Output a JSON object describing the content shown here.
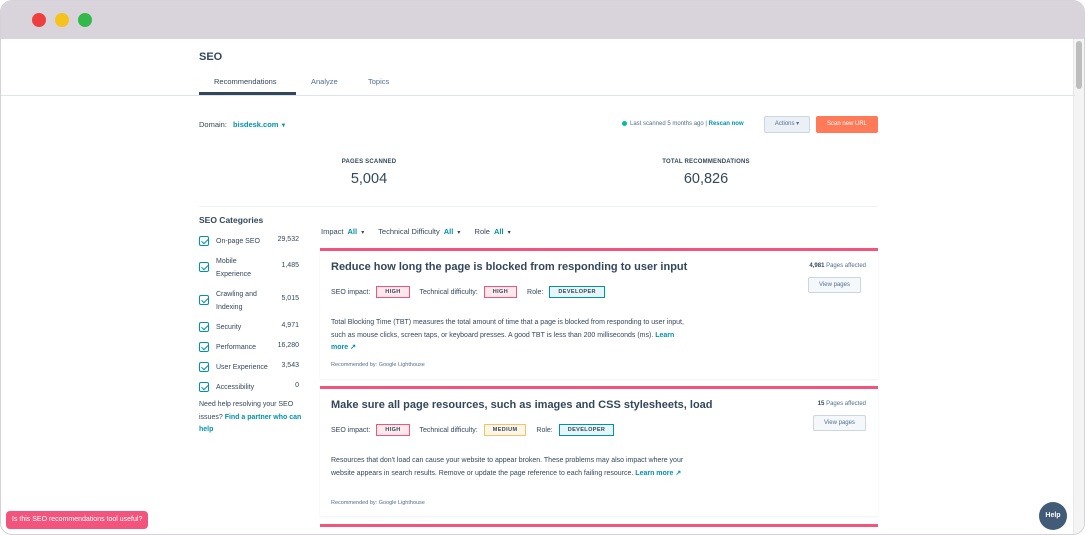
{
  "window": {
    "controls": [
      "close",
      "minimize",
      "maximize"
    ]
  },
  "page": {
    "title": "SEO",
    "tabs": [
      {
        "label": "Recommendations",
        "active": true
      },
      {
        "label": "Analyze",
        "active": false
      },
      {
        "label": "Topics",
        "active": false
      }
    ]
  },
  "domain": {
    "label": "Domain:",
    "value": "bisdesk.com"
  },
  "status": {
    "text": "Last scanned 5 months ago",
    "separator": "|",
    "rescan": "Rescan now",
    "actions": "Actions",
    "scan_new": "Scan new URL"
  },
  "stats": {
    "pages_scanned_label": "PAGES SCANNED",
    "pages_scanned_value": "5,004",
    "total_recs_label": "TOTAL RECOMMENDATIONS",
    "total_recs_value": "60,826"
  },
  "sidebar": {
    "title": "SEO Categories",
    "categories": [
      {
        "label": "On-page SEO",
        "count": "29,532",
        "checked": true
      },
      {
        "label": "Mobile Experience",
        "count": "1,485",
        "checked": true
      },
      {
        "label": "Crawling and Indexing",
        "count": "5,015",
        "checked": true
      },
      {
        "label": "Security",
        "count": "4,971",
        "checked": true
      },
      {
        "label": "Performance",
        "count": "16,280",
        "checked": true
      },
      {
        "label": "User Experience",
        "count": "3,543",
        "checked": true
      },
      {
        "label": "Accessibility",
        "count": "0",
        "checked": true
      }
    ],
    "help_text": "Need help resolving your SEO issues?",
    "help_link": "Find a partner who can help"
  },
  "filters": [
    {
      "label": "Impact",
      "value": "All"
    },
    {
      "label": "Technical Difficulty",
      "value": "All"
    },
    {
      "label": "Role",
      "value": "All"
    }
  ],
  "cards": [
    {
      "title": "Reduce how long the page is blocked from responding to user input",
      "affected_count": "4,981",
      "affected_label": "Pages affected",
      "view_label": "View pages",
      "seo_impact_label": "SEO impact:",
      "seo_impact": "HIGH",
      "difficulty_label": "Technical difficulty:",
      "difficulty": "HIGH",
      "role_label": "Role:",
      "role": "DEVELOPER",
      "description": "Total Blocking Time (TBT) measures the total amount of time that a page is blocked from responding to user input, such as mouse clicks, screen taps, or keyboard presses. A good TBT is less than 200 milliseconds (ms).",
      "learn_more": "Learn more",
      "recommended_by": "Recommended by: Google Lighthouse"
    },
    {
      "title": "Make sure all page resources, such as images and CSS stylesheets, load",
      "affected_count": "15",
      "affected_label": "Pages affected",
      "view_label": "View pages",
      "seo_impact_label": "SEO impact:",
      "seo_impact": "HIGH",
      "difficulty_label": "Technical difficulty:",
      "difficulty": "MEDIUM",
      "role_label": "Role:",
      "role": "DEVELOPER",
      "description": "Resources that don't load can cause your website to appear broken. These problems may also impact where your website appears in search results. Remove or update the page reference to each failing resource.",
      "learn_more": "Learn more",
      "recommended_by": "Recommended by: Google Lighthouse"
    }
  ],
  "feedback": "Is this SEO recommendations tool useful?",
  "help": "Help",
  "colors": {
    "accent": "#0091ae",
    "cta": "#ff7a59",
    "card_border": "#f2547d",
    "text": "#33475b"
  }
}
